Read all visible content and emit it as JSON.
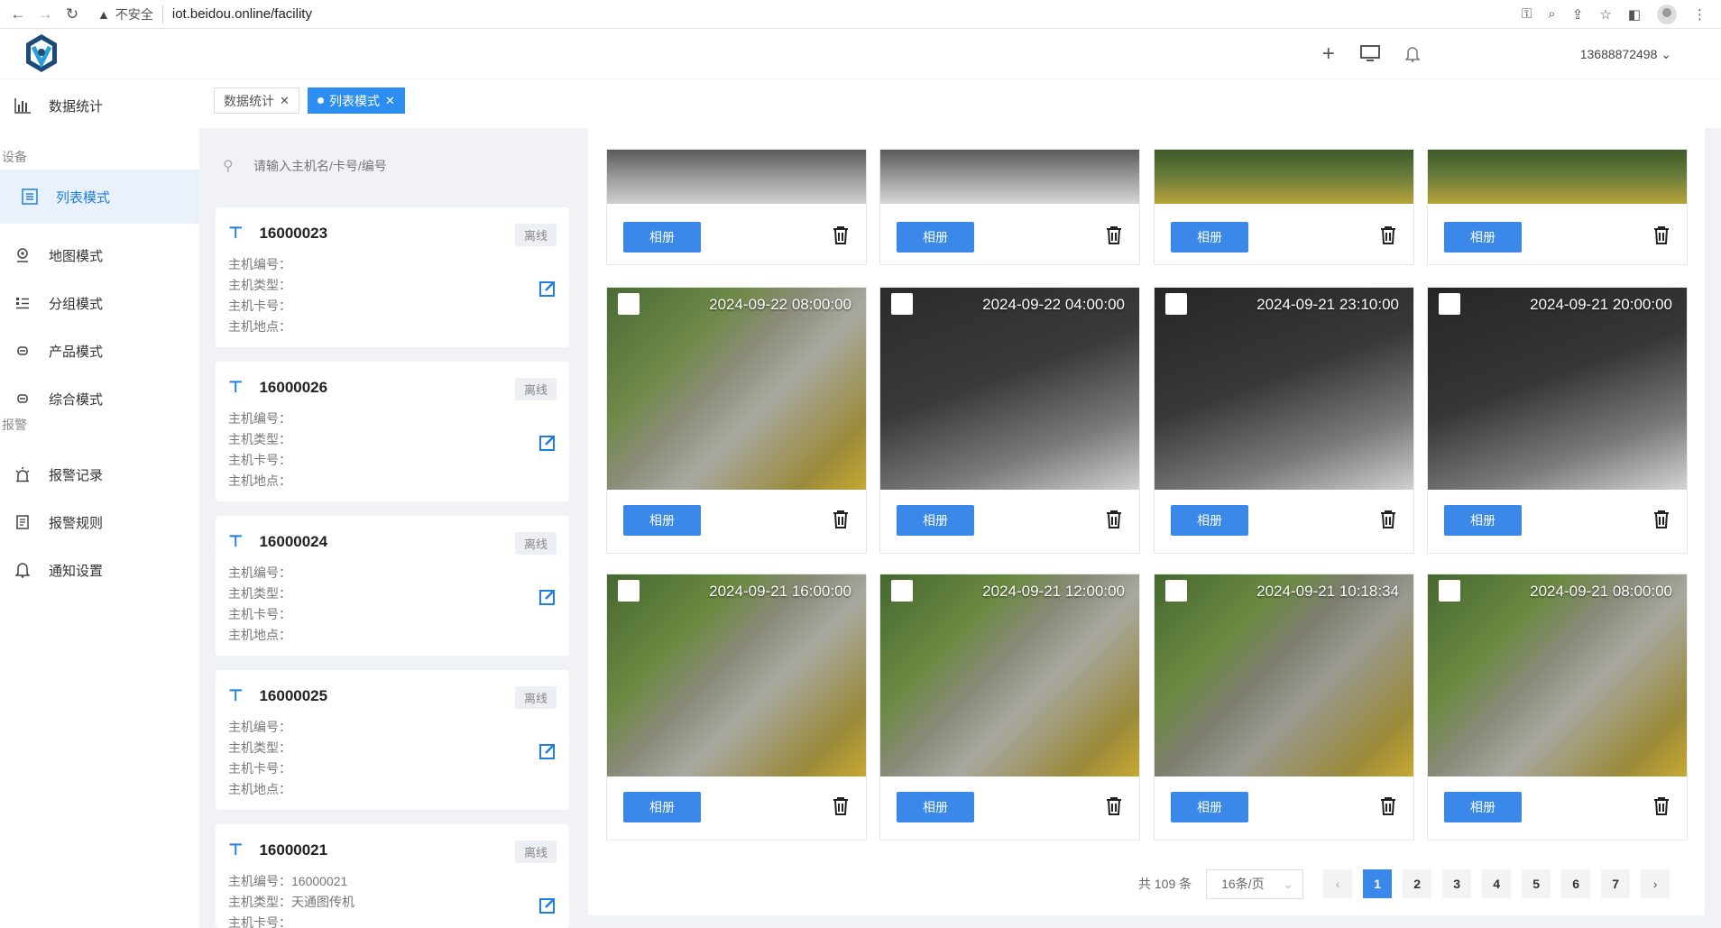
{
  "browser": {
    "insecure_label": "不安全",
    "url": "iot.beidou.online/facility"
  },
  "header": {
    "user": "13688872498"
  },
  "tabs": [
    {
      "label": "数据统计",
      "active": false
    },
    {
      "label": "列表模式",
      "active": true
    }
  ],
  "sidebar": {
    "top_item": "数据统计",
    "group_device": "设备",
    "group_alarm": "报警",
    "items": [
      {
        "label": "列表模式",
        "icon": "list-icon",
        "active": true
      },
      {
        "label": "地图模式",
        "icon": "map-pin-icon"
      },
      {
        "label": "分组模式",
        "icon": "group-icon"
      },
      {
        "label": "产品模式",
        "icon": "product-icon"
      },
      {
        "label": "综合模式",
        "icon": "composite-icon"
      },
      {
        "label": "报警记录",
        "icon": "alarm-icon"
      },
      {
        "label": "报警规则",
        "icon": "rule-icon"
      },
      {
        "label": "通知设置",
        "icon": "bell-icon"
      }
    ]
  },
  "search": {
    "placeholder": "请输入主机名/卡号/编号"
  },
  "devices": [
    {
      "id": "16000023",
      "status": "离线",
      "rows": [
        "主机编号：",
        "主机类型：",
        "主机卡号：",
        "主机地点："
      ]
    },
    {
      "id": "16000026",
      "status": "离线",
      "rows": [
        "主机编号：",
        "主机类型：",
        "主机卡号：",
        "主机地点："
      ]
    },
    {
      "id": "16000024",
      "status": "离线",
      "rows": [
        "主机编号：",
        "主机类型：",
        "主机卡号：",
        "主机地点："
      ]
    },
    {
      "id": "16000025",
      "status": "离线",
      "rows": [
        "主机编号：",
        "主机类型：",
        "主机卡号：",
        "主机地点："
      ]
    },
    {
      "id": "16000021",
      "status": "离线",
      "rows": [
        "主机编号：16000021",
        "主机类型：天通图传机",
        "主机卡号："
      ]
    }
  ],
  "photos": {
    "album_label": "相册",
    "row1": [
      {
        "ts": "2024-09-22 08:00:00",
        "mode": "day"
      },
      {
        "ts": "2024-09-22 04:00:00",
        "mode": "night"
      },
      {
        "ts": "2024-09-21 23:10:00",
        "mode": "night"
      },
      {
        "ts": "2024-09-21 20:00:00",
        "mode": "night"
      }
    ],
    "row2": [
      {
        "ts": "2024-09-21 16:00:00",
        "mode": "day"
      },
      {
        "ts": "2024-09-21 12:00:00",
        "mode": "day"
      },
      {
        "ts": "2024-09-21 10:18:34",
        "mode": "day"
      },
      {
        "ts": "2024-09-21 08:00:00",
        "mode": "day"
      }
    ]
  },
  "pagination": {
    "total": "共 109 条",
    "page_size": "16条/页",
    "pages": [
      "1",
      "2",
      "3",
      "4",
      "5",
      "6",
      "7"
    ],
    "current": "1"
  }
}
